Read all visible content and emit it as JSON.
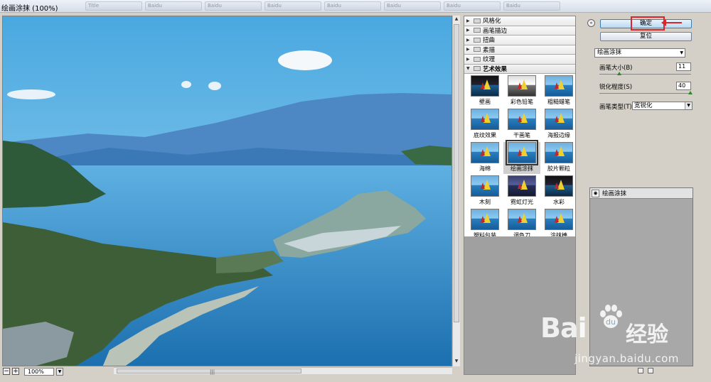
{
  "window": {
    "title": "绘画涂抹 (100%)"
  },
  "taskbar": [
    "Title",
    "Baidu",
    "Baidu",
    "Baidu",
    "Baidu",
    "Baidu",
    "Baidu",
    "Baidu"
  ],
  "preview": {
    "zoom": "100%",
    "zoom_out_symbol": "−",
    "zoom_in_symbol": "+"
  },
  "filter_gallery": {
    "categories": [
      {
        "label": "风格化",
        "open": false
      },
      {
        "label": "画笔描边",
        "open": false
      },
      {
        "label": "扭曲",
        "open": false
      },
      {
        "label": "素描",
        "open": false
      },
      {
        "label": "纹理",
        "open": false
      },
      {
        "label": "艺术效果",
        "open": true
      }
    ],
    "filters": [
      {
        "label": "壁画",
        "style": "dark"
      },
      {
        "label": "彩色铅笔",
        "style": "bw"
      },
      {
        "label": "粗糙蜡笔",
        "style": "normal"
      },
      {
        "label": "底纹效果",
        "style": "normal"
      },
      {
        "label": "干画笔",
        "style": "normal"
      },
      {
        "label": "海报边缘",
        "style": "normal"
      },
      {
        "label": "海绵",
        "style": "normal"
      },
      {
        "label": "绘画涂抹",
        "style": "normal",
        "selected": true
      },
      {
        "label": "胶片颗粒",
        "style": "normal"
      },
      {
        "label": "木刻",
        "style": "normal"
      },
      {
        "label": "霓虹灯光",
        "style": "neon"
      },
      {
        "label": "水彩",
        "style": "dark"
      },
      {
        "label": "塑料包装",
        "style": "normal"
      },
      {
        "label": "调色刀",
        "style": "normal"
      },
      {
        "label": "涂抹棒",
        "style": "normal"
      }
    ]
  },
  "buttons": {
    "ok": "确定",
    "reset": "复位",
    "collapse_symbol": "«"
  },
  "settings": {
    "filter_select": "绘画涂抹",
    "brush_size_label": "画笔大小(B)",
    "brush_size_value": "11",
    "brush_size_level": 0.22,
    "sharpness_label": "锐化程度(S)",
    "sharpness_value": "40",
    "sharpness_level": 1.0,
    "brush_type_label": "画笔类型(T):",
    "brush_type_value": "宽锐化"
  },
  "layers": [
    {
      "label": "绘画涂抹"
    }
  ],
  "watermark": {
    "brand": "Bai",
    "cn": "经验",
    "url": "jingyan.baidu.com"
  },
  "colors": {
    "accent_red": "#d9262c",
    "water": "#2b86c8",
    "sky": "#7cc4ea"
  }
}
